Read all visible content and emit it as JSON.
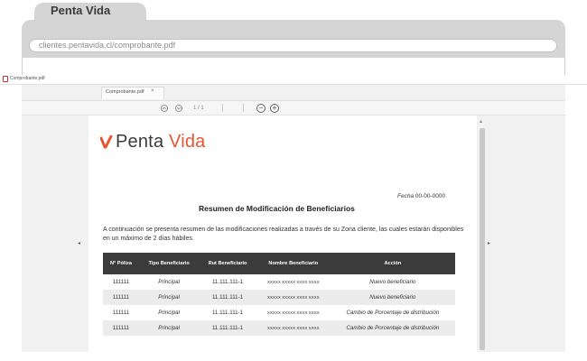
{
  "browser": {
    "tab_title": "Penta Vida",
    "url": "clientes.pentavida.cl/comprobante.pdf"
  },
  "file_bar": {
    "title": "Comprobante.pdf"
  },
  "viewer": {
    "tab_title": "Comprobante.pdf",
    "tab_close": "×",
    "page_indicator": "1 / 1",
    "zoom_out": "−",
    "zoom_in": "+",
    "prev_arrow": "◂",
    "next_arrow": "▸",
    "scroll_up": "▴"
  },
  "document": {
    "logo_primary": "Penta ",
    "logo_accent": "Vida",
    "fecha_label": "Fecha",
    "fecha_value": "00-00-0000",
    "title": "Resumen de Modificación de Beneficiarios",
    "intro": "A continuación se presenta resumen de las modificaciones realizadas a través de su Zona cliente, las cuales estarán disponibles en un máximo de 2 días hábiles.",
    "table": {
      "headers": [
        "N° Póliza",
        "Tipo Beneficiario",
        "Rut Beneficiario",
        "Nombre Beneficiario",
        "Acción"
      ],
      "rows": [
        [
          "111111",
          "Principal",
          "11.111.111-1",
          "XXXXX XXXXX XXXX XXXX",
          "Nuevo beneficiario"
        ],
        [
          "111111",
          "Principal",
          "11.111.111-1",
          "XXXXX XXXXX XXXX XXXX",
          "Nuevo beneficiario"
        ],
        [
          "111111",
          "Principal",
          "11.111.111-1",
          "XXXXX XXXXX XXXX XXXX",
          "Cambio de Porcentaje de distribución"
        ],
        [
          "111111",
          "Principal",
          "11.111.111-1",
          "XXXXX XXXXX XXXX XXXX",
          "Cambio de Porcentaje de distribución"
        ]
      ]
    }
  },
  "colors": {
    "accent": "#e8542f",
    "header_bg": "#3b3b3b",
    "chrome": "#d5d5d5"
  }
}
